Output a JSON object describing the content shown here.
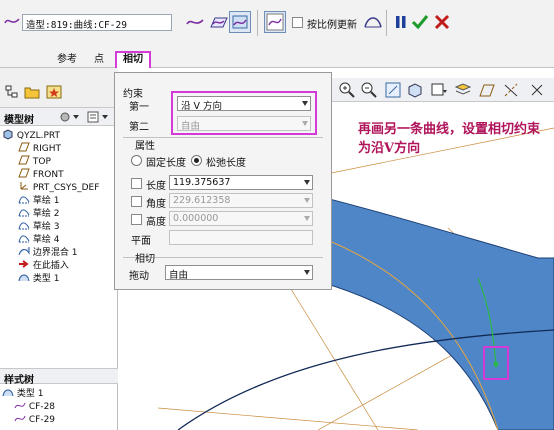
{
  "toolbar": {
    "curve_field": "造型:819:曲线:CF-29",
    "scale_update_label": "按比例更新"
  },
  "tabs": [
    "参考",
    "点",
    "相切"
  ],
  "left_panel": {
    "model_tree_label": "模型树",
    "tree_items": [
      "QYZL.PRT",
      "RIGHT",
      "TOP",
      "FRONT",
      "PRT_CSYS_DEF",
      "草绘 1",
      "草绘 2",
      "草绘 3",
      "草绘 4",
      "边界混合 1",
      "在此插入",
      "类型 1"
    ],
    "style_tree_label": "样式树",
    "style_items": [
      "类型 1",
      "CF-28",
      "CF-29"
    ]
  },
  "dialog": {
    "constraint_group": "约束",
    "first_label": "第一",
    "first_value": "沿 V 方向",
    "second_label": "第二",
    "second_value": "自由",
    "property_group": "属性",
    "fixed_length": "固定长度",
    "relaxed_length": "松弛长度",
    "length_label": "长度",
    "length_value": "119.375637",
    "angle_label": "角度",
    "angle_value": "229.612358",
    "height_label": "高度",
    "height_value": "0.000000",
    "plane_label": "平面",
    "tangency_group": "相切",
    "drag_label": "拖动",
    "drag_value": "自由"
  },
  "annotation": "再画另一条曲线，设置相切约束为沿V方向",
  "colors": {
    "surface": "#4f86c7",
    "highlight": "#d63ad6",
    "annotation": "#b0145a"
  }
}
